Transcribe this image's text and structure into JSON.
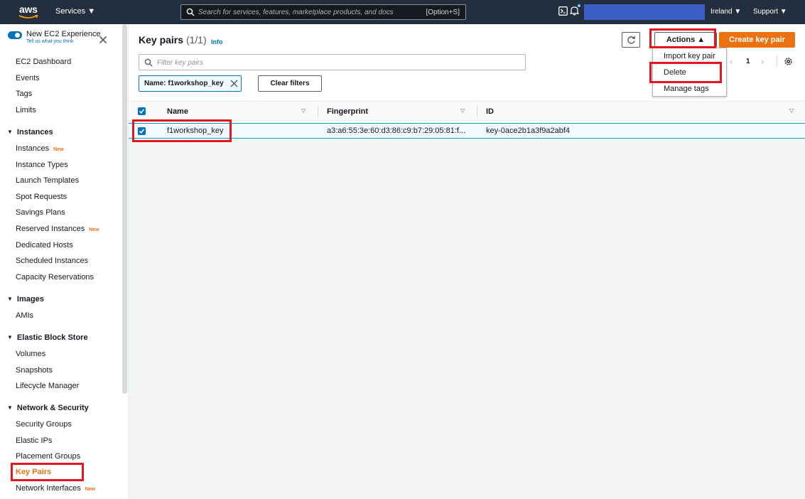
{
  "topnav": {
    "logo_text": "aws",
    "services_label": "Services ▼",
    "search_placeholder": "Search for services, features, marketplace products, and docs",
    "search_shortcut": "[Option+S]",
    "region_label": "Ireland ▼",
    "support_label": "Support ▼",
    "account_color": "#3b5fc4"
  },
  "sidebar": {
    "new_experience_title": "New EC2 Experience",
    "new_experience_subtitle": "Tell us what you think",
    "top_items": [
      "EC2 Dashboard",
      "Events",
      "Tags",
      "Limits"
    ],
    "instances_section": "Instances",
    "instances_items": [
      {
        "label": "Instances",
        "badge": "New"
      },
      {
        "label": "Instance Types",
        "badge": ""
      },
      {
        "label": "Launch Templates",
        "badge": ""
      },
      {
        "label": "Spot Requests",
        "badge": ""
      },
      {
        "label": "Savings Plans",
        "badge": ""
      },
      {
        "label": "Reserved Instances",
        "badge": "New"
      },
      {
        "label": "Dedicated Hosts",
        "badge": ""
      },
      {
        "label": "Scheduled Instances",
        "badge": ""
      },
      {
        "label": "Capacity Reservations",
        "badge": ""
      }
    ],
    "images_section": "Images",
    "images_items": [
      "AMIs"
    ],
    "ebs_section": "Elastic Block Store",
    "ebs_items": [
      "Volumes",
      "Snapshots",
      "Lifecycle Manager"
    ],
    "network_section": "Network & Security",
    "network_items": [
      {
        "label": "Security Groups",
        "badge": ""
      },
      {
        "label": "Elastic IPs",
        "badge": ""
      },
      {
        "label": "Placement Groups",
        "badge": ""
      },
      {
        "label": "Key Pairs",
        "badge": ""
      },
      {
        "label": "Network Interfaces",
        "badge": "New"
      }
    ]
  },
  "main": {
    "title": "Key pairs",
    "count": "(1/1)",
    "info_label": "Info",
    "actions_label": "Actions ▲",
    "create_label": "Create key pair",
    "filter_placeholder": "Filter key pairs",
    "token_label": "Name: f1workshop_key",
    "clear_filters_label": "Clear filters",
    "page_number": "1",
    "columns": [
      "Name",
      "Fingerprint",
      "ID"
    ],
    "rows": [
      {
        "name": "f1workshop_key",
        "fingerprint": "a3:a6:55:3e:60:d3:86:c9:b7:29:05:81:f...",
        "id": "key-0ace2b1a3f9a2abf4",
        "selected": true
      }
    ],
    "actions_menu": [
      "Import key pair",
      "Delete",
      "Manage tags"
    ]
  },
  "colors": {
    "nav_bg": "#232f3e",
    "accent_orange": "#ec7211",
    "link_blue": "#0073bb",
    "highlight_red": "#e5141e"
  }
}
